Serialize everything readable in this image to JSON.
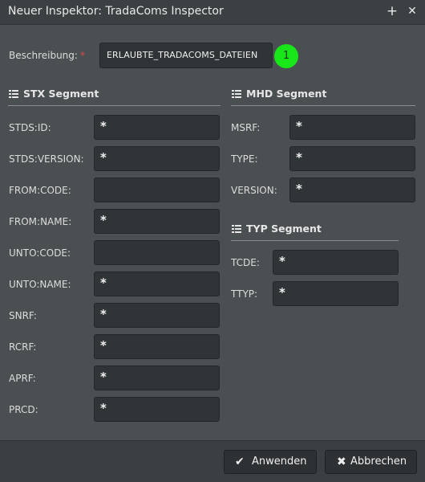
{
  "window": {
    "title": "Neuer Inspektor: TradaComs Inspector",
    "add_label": "+",
    "close_label": "✕"
  },
  "description": {
    "label": "Beschreibung:",
    "required_mark": "*",
    "value": "ERLAUBTE_TRADACOMS_DATEIEN",
    "badge": "1"
  },
  "stx": {
    "title": "STX Segment",
    "fields": [
      {
        "label": "STDS:ID:",
        "value": "*"
      },
      {
        "label": "STDS:VERSION:",
        "value": "*"
      },
      {
        "label": "FROM:CODE:",
        "value": ""
      },
      {
        "label": "FROM:NAME:",
        "value": "*"
      },
      {
        "label": "UNTO:CODE:",
        "value": ""
      },
      {
        "label": "UNTO:NAME:",
        "value": "*"
      },
      {
        "label": "SNRF:",
        "value": "*"
      },
      {
        "label": "RCRF:",
        "value": "*"
      },
      {
        "label": "APRF:",
        "value": "*"
      },
      {
        "label": "PRCD:",
        "value": "*"
      }
    ]
  },
  "mhd": {
    "title": "MHD Segment",
    "fields": [
      {
        "label": "MSRF:",
        "value": "*"
      },
      {
        "label": "TYPE:",
        "value": "*"
      },
      {
        "label": "VERSION:",
        "value": "*"
      }
    ]
  },
  "typ": {
    "title": "TYP Segment",
    "fields": [
      {
        "label": "TCDE:",
        "value": "*"
      },
      {
        "label": "TTYP:",
        "value": "*"
      }
    ]
  },
  "footer": {
    "apply_label": "Anwenden",
    "cancel_label": "Abbrechen"
  }
}
